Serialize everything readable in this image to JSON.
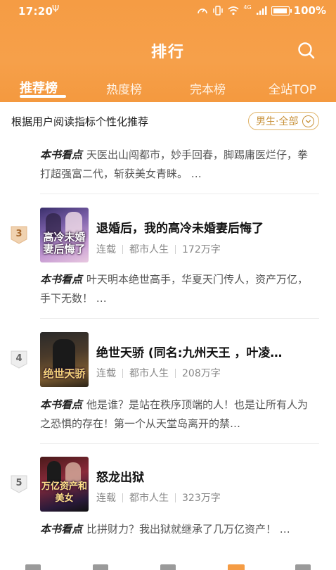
{
  "status_bar": {
    "time": "17:20",
    "network_label": "4G",
    "battery_percent": 100,
    "battery_text": "100%"
  },
  "header": {
    "title": "排行",
    "search_icon": "search-icon",
    "tabs": [
      {
        "label": "推荐榜",
        "active": true
      },
      {
        "label": "热度榜",
        "active": false
      },
      {
        "label": "完本榜",
        "active": false
      },
      {
        "label": "全站TOP",
        "active": false
      }
    ]
  },
  "subheader": {
    "description": "根据用户阅读指标个性化推荐",
    "filter_label": "男生·全部"
  },
  "highlight_label": "本书看点",
  "list": {
    "partial_item": {
      "highlight": "天医出山闯都市，妙手回春，脚踢庸医烂仔，拳打超强富二代，斩获美女青睐。 …"
    },
    "items": [
      {
        "rank": "3",
        "cover_text": "高冷未婚妻后悔了",
        "title": "退婚后，我的高冷未婚妻后悔了",
        "status": "连载",
        "category": "都市人生",
        "word_count": "172万字",
        "highlight": "叶天明本绝世高手，华夏天门传人，资产万亿，手下无数！ …"
      },
      {
        "rank": "4",
        "cover_text": "绝世天骄",
        "title": "绝世天骄 (同名:九州天王 ，叶凌…",
        "status": "连载",
        "category": "都市人生",
        "word_count": "208万字",
        "highlight": "他是谁？是站在秩序顶端的人！也是让所有人为之恐惧的存在！第一个从天堂岛离开的禁…"
      },
      {
        "rank": "5",
        "cover_text": "万亿资产和美女",
        "title": "怒龙出狱",
        "status": "连载",
        "category": "都市人生",
        "word_count": "323万字",
        "highlight": "比拼财力？我出狱就继承了几万亿资产！ …"
      }
    ]
  },
  "colors": {
    "brand_orange": "#f59c44",
    "filter_gold": "#c8923b",
    "rank_badge": "#f0d2b0"
  }
}
